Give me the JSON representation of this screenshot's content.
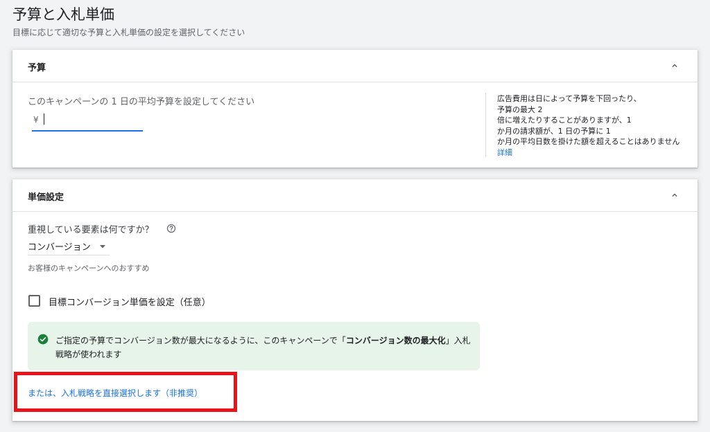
{
  "page": {
    "title": "予算と入札単価",
    "subtitle": "目標に応じて適切な予算と入札単価の設定を選択してください"
  },
  "budget_section": {
    "title": "予算",
    "prompt": "このキャンペーンの 1 日の平均予算を設定してください",
    "currency_symbol": "¥",
    "input_value": "",
    "help_lines": [
      "広告費用は日によって予算を下回ったり、",
      "予算の最大 2",
      "倍に増えたりすることがありますが、1",
      "か月の請求額が、1 日の予算に 1",
      "か月の平均日数を掛けた額を超えることはありません"
    ],
    "help_link": "詳細"
  },
  "bid_section": {
    "title": "単価設定",
    "question": "重視している要素は何ですか？",
    "dropdown_value": "コンバージョン",
    "recommendation": "お客様のキャンペーンへのおすすめ",
    "checkbox_label": "目標コンバージョン単価を設定（任意）",
    "checkbox_checked": false,
    "info_text_before": "ご指定の予算でコンバージョン数が最大になるように、このキャンペーンで「",
    "info_text_bold": "コンバージョン数の最大化",
    "info_text_after": "」入札戦略が使われます",
    "direct_select_link": "または、入札戦略を直接選択します（非推奨）"
  },
  "colors": {
    "accent_blue": "#1a73e8",
    "success_green": "#188038",
    "info_bg": "#e6f4ea",
    "highlight_red": "#e8141c"
  },
  "icons": {
    "collapse": "chevron-up-icon",
    "help": "help-circle-icon",
    "dropdown": "arrow-drop-down-icon",
    "success": "check-circle-icon"
  }
}
